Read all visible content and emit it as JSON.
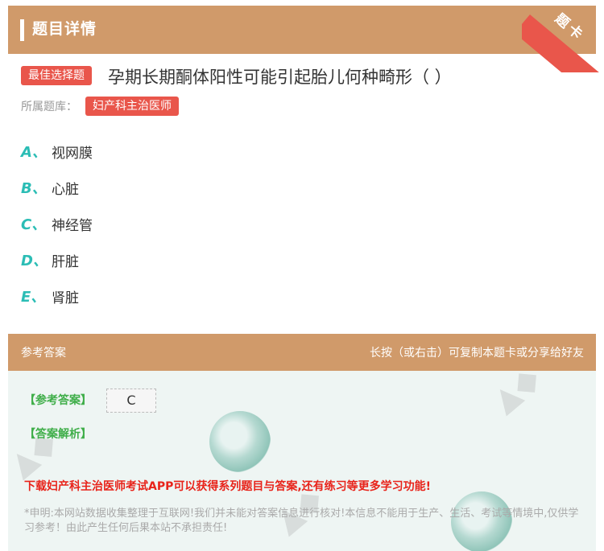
{
  "header": {
    "title": "题目详情",
    "corner_label": "题卡"
  },
  "question": {
    "type_tag": "最佳选择题",
    "text": "孕期长期酮体阳性可能引起胎儿何种畸形（ ）",
    "library_label": "所属题库：",
    "library_name": "妇产科主治医师"
  },
  "options": [
    {
      "letter": "A、",
      "text": "视网膜"
    },
    {
      "letter": "B、",
      "text": "心脏"
    },
    {
      "letter": "C、",
      "text": "神经管"
    },
    {
      "letter": "D、",
      "text": "肝脏"
    },
    {
      "letter": "E、",
      "text": "肾脏"
    }
  ],
  "answer_section": {
    "title": "参考答案",
    "hint": "长按（或右击）可复制本题卡或分享给好友",
    "key_label": "【参考答案】",
    "key_value": "C",
    "explanation_label": "【答案解析】",
    "promo": "下载妇产科主治医师考试APP可以获得系列题目与答案,还有练习等更多学习功能!",
    "disclaimer": "*申明:本网站数据收集整理于互联网!我们并未能对答案信息进行核对!本信息不能用于生产、生活、考试等情境中,仅供学习参考！由此产生任何后果本站不承担责任!"
  },
  "colors": {
    "header_bg": "#d09a6a",
    "tag_red": "#e9564b",
    "option_letter": "#2bbdb5",
    "answer_green": "#3fae49",
    "promo_red": "#e8231a",
    "answer_panel_bg": "#eef5f3"
  }
}
